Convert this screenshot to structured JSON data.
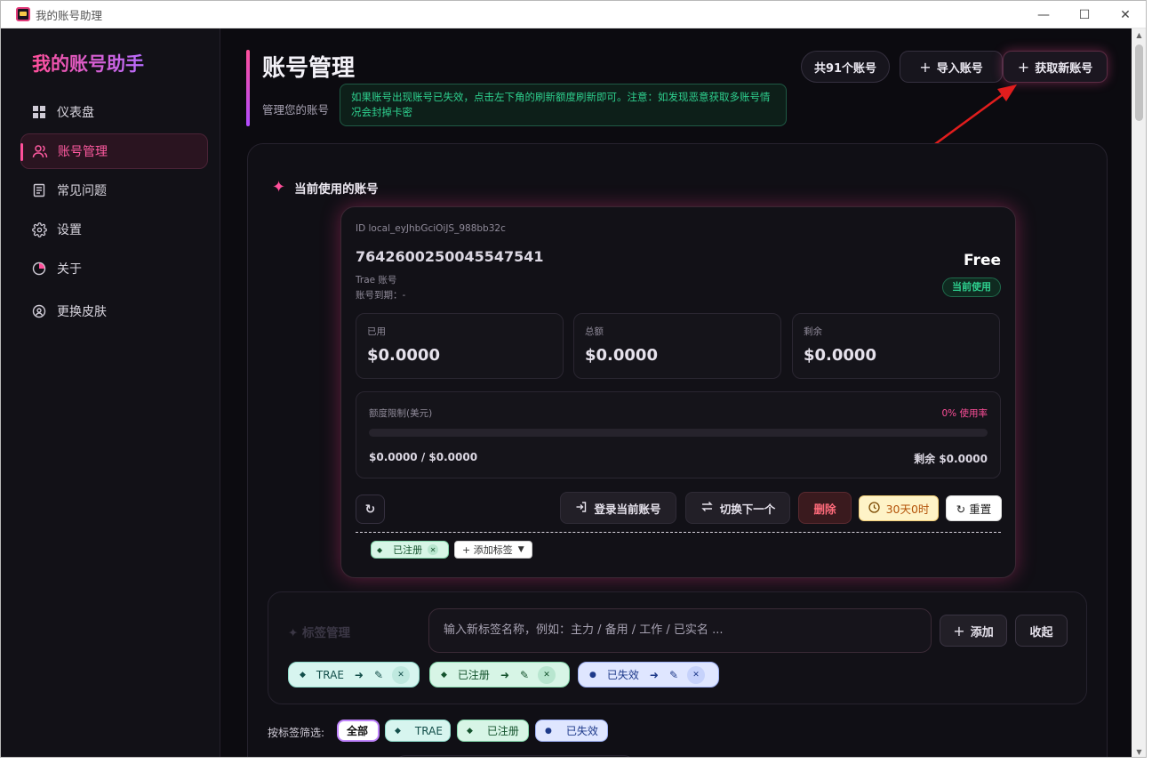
{
  "window": {
    "title": "我的账号助理",
    "minimize_glyph": "—",
    "maximize_glyph": "☐",
    "close_glyph": "✕"
  },
  "sidebar": {
    "brand": "我的账号助手",
    "items": [
      {
        "label": "仪表盘",
        "icon": "dashboard-icon"
      },
      {
        "label": "账号管理",
        "icon": "users-icon",
        "active": true
      },
      {
        "label": "常见问题",
        "icon": "book-icon"
      },
      {
        "label": "设置",
        "icon": "gear-icon"
      },
      {
        "label": "关于",
        "icon": "info-icon"
      },
      {
        "label": "更换皮肤",
        "icon": "palette-icon"
      }
    ]
  },
  "header": {
    "title": "账号管理",
    "subtitle": "管理您的账号",
    "notice": "如果账号出现账号已失效，点击左下角的刷新额度刷新即可。注意：如发现恶意获取多账号情况会封掉卡密",
    "count_label": "共91个账号",
    "import_label": "导入账号",
    "fetch_label": "获取新账号"
  },
  "current": {
    "section_title": "当前使用的账号",
    "id_text": "ID local_eyJhbGciOiJS_988bb32c",
    "account_number": "7642600250045547541",
    "account_type": "Trae 账号",
    "expiry": "账号到期：-",
    "plan": "Free",
    "status_badge": "当前使用",
    "stats": [
      {
        "label": "已用",
        "value": "$0.0000"
      },
      {
        "label": "总额",
        "value": "$0.0000"
      },
      {
        "label": "剩余",
        "value": "$0.0000"
      }
    ],
    "quota": {
      "label": "额度限制(美元)",
      "rate": "0% 使用率",
      "percent": 0,
      "used_total": "$0.0000 / $0.0000",
      "remaining": "剩余 $0.0000"
    },
    "actions": {
      "refresh_glyph": "↻",
      "login": "登录当前账号",
      "switch": "切换下一个",
      "delete": "删除",
      "timer": "30天0时",
      "reset": "↻ 重置"
    },
    "tags": [
      {
        "label": "已注册"
      }
    ],
    "add_tag_label": "+ 添加标签"
  },
  "tag_manager": {
    "title": "标签管理",
    "input_placeholder": "输入新标签名称，例如：主力 / 备用 / 工作 / 已实名 ...",
    "add_label": "添加",
    "fold_label": "收起",
    "tags": [
      {
        "label": "TRAE"
      },
      {
        "label": "已注册"
      },
      {
        "label": "已失效"
      }
    ]
  },
  "filter": {
    "label": "按标签筛选:",
    "options": [
      {
        "label": "全部",
        "selected": true
      },
      {
        "label": "TRAE"
      },
      {
        "label": "已注册"
      },
      {
        "label": "已失效"
      }
    ]
  },
  "colors": {
    "accent": "#ff4f9a",
    "success": "#2ecf8e",
    "background": "#0c0b10"
  }
}
